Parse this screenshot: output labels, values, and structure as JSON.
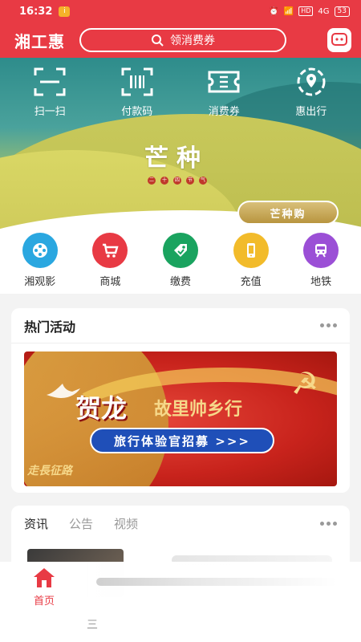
{
  "status_bar": {
    "time": "16:32",
    "notif_badge": "i",
    "hd_label": "HD",
    "signal_label": "4G",
    "battery": "53"
  },
  "header": {
    "logo": "湘工惠",
    "search_text": "领消费券"
  },
  "quick_actions": [
    {
      "label": "扫一扫",
      "icon": "scan-icon"
    },
    {
      "label": "付款码",
      "icon": "barcode-icon"
    },
    {
      "label": "消费券",
      "icon": "ticket-icon"
    },
    {
      "label": "惠出行",
      "icon": "location-icon"
    }
  ],
  "hero": {
    "title": "芒种",
    "badge_chars": [
      "二",
      "十",
      "四",
      "节",
      "气"
    ],
    "button": "芒种购"
  },
  "services": [
    {
      "label": "湘观影",
      "icon": "film-icon",
      "color": "#2aa7e0"
    },
    {
      "label": "商城",
      "icon": "cart-icon",
      "color": "#e83a44"
    },
    {
      "label": "缴费",
      "icon": "tag-icon",
      "color": "#1aa35f"
    },
    {
      "label": "充值",
      "icon": "phone-icon",
      "color": "#f2bb2a"
    },
    {
      "label": "地铁",
      "icon": "metro-icon",
      "color": "#9b4fd6"
    }
  ],
  "hot": {
    "title": "热门活动",
    "banner_main": "贺龙",
    "banner_sub": "故里帅乡行",
    "banner_pill": "旅行体验官招募 >>>",
    "banner_script": "走長征路"
  },
  "news": {
    "tabs": [
      "资讯",
      "公告",
      "视频"
    ]
  },
  "bottom_nav": {
    "home": "首页",
    "mark": "三"
  }
}
